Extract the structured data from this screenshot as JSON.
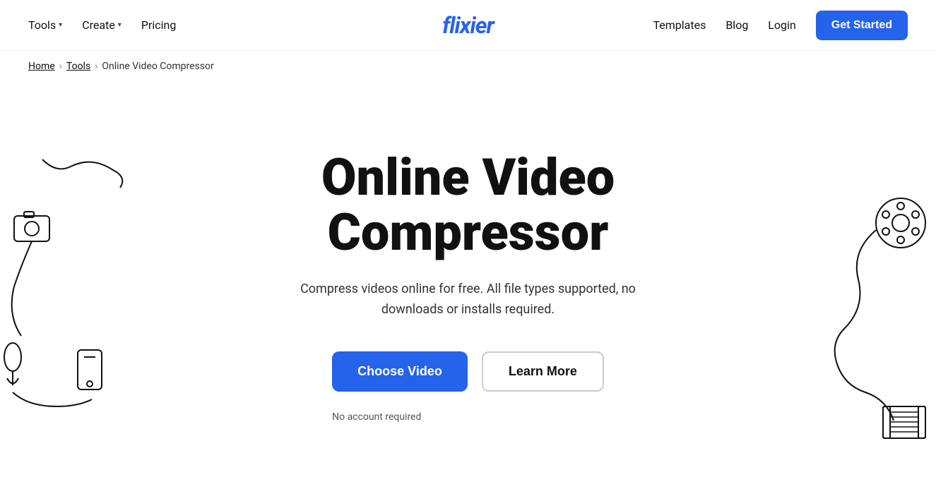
{
  "nav": {
    "logo": "flixier",
    "left": [
      {
        "label": "Tools",
        "hasDropdown": true
      },
      {
        "label": "Create",
        "hasDropdown": true
      },
      {
        "label": "Pricing",
        "hasDropdown": false
      }
    ],
    "right": [
      {
        "label": "Templates"
      },
      {
        "label": "Blog"
      },
      {
        "label": "Login"
      }
    ],
    "cta": "Get Started"
  },
  "breadcrumb": {
    "home": "Home",
    "tools": "Tools",
    "current": "Online Video Compressor"
  },
  "hero": {
    "title": "Online Video Compressor",
    "subtitle": "Compress videos online for free. All file types supported, no downloads or installs required.",
    "choose_video": "Choose Video",
    "learn_more": "Learn More",
    "no_account": "No account required"
  }
}
